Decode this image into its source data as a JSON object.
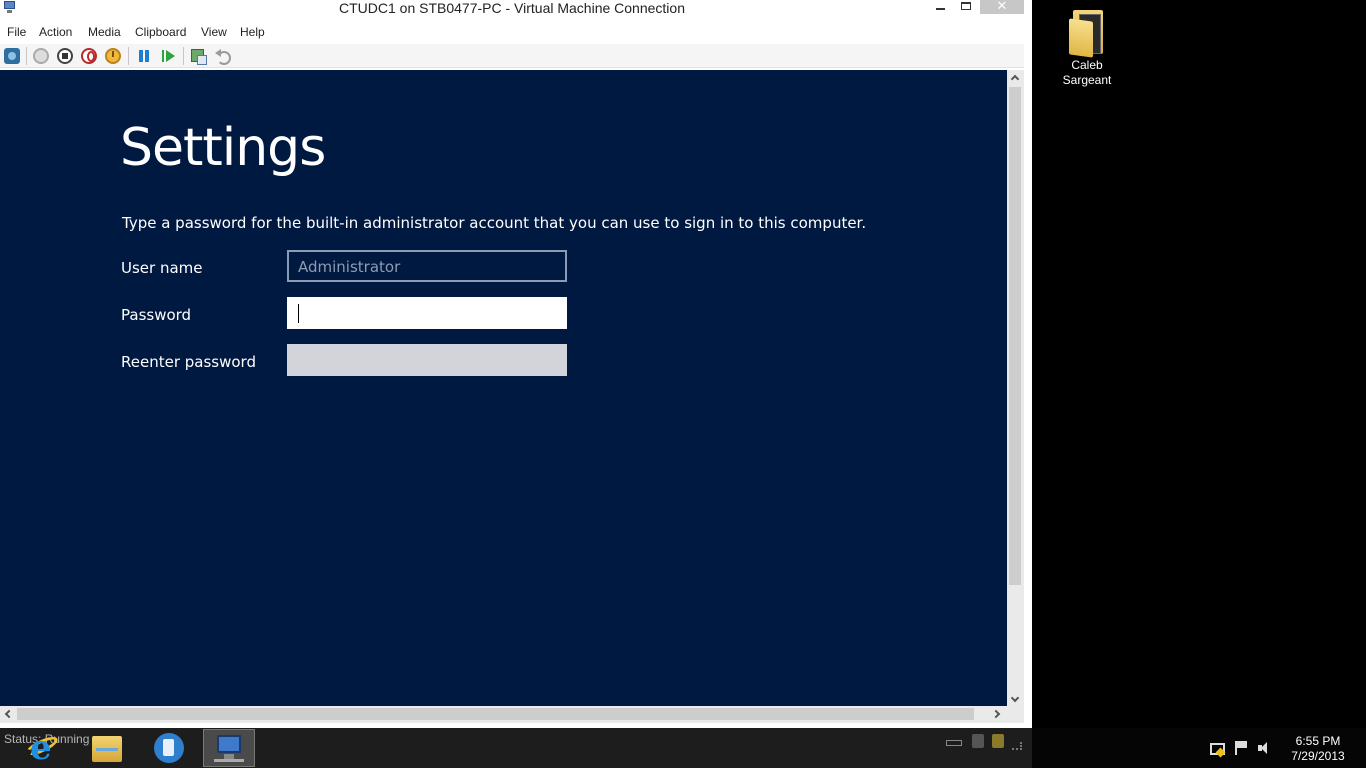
{
  "window": {
    "title": "CTUDC1 on STB0477-PC - Virtual Machine Connection",
    "close_glyph": "✕"
  },
  "menu": {
    "file": "File",
    "action": "Action",
    "media": "Media",
    "clipboard": "Clipboard",
    "view": "View",
    "help": "Help"
  },
  "toolbar": {
    "icons": [
      "ctrl-alt-del-icon",
      "start-icon",
      "turn-off-icon",
      "shutdown-icon",
      "save-icon",
      "pause-icon",
      "resume-icon",
      "checkpoint-icon",
      "revert-icon"
    ]
  },
  "guest": {
    "title": "Settings",
    "instruction": "Type a password for the built-in administrator account that you can use to sign in to this computer.",
    "username_label": "User name",
    "username_value": "Administrator",
    "password_label": "Password",
    "password_value": "",
    "reenter_label": "Reenter password",
    "reenter_value": "",
    "background_color": "#001941"
  },
  "status_bar": {
    "text": "Status: Running"
  },
  "desktop": {
    "icon_label_line1": "Caleb",
    "icon_label_line2": "Sargeant"
  },
  "clock": {
    "time": "6:55 PM",
    "date": "7/29/2013"
  }
}
